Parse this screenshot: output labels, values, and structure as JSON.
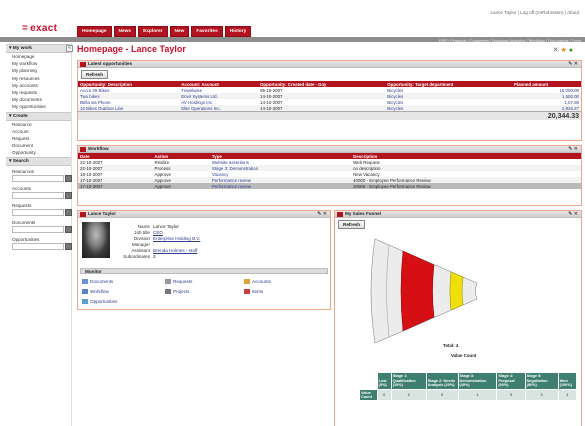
{
  "app": {
    "logo": "exact",
    "logo_prefix": "="
  },
  "top_links": "Lance Taylor | Log off (mrRohrssen) | About",
  "nav_tabs": [
    "Homepage",
    "News",
    "Explorer",
    "New",
    "Favorites",
    "History"
  ],
  "gray_links": "ERP | Financial | Customers | Business Analytics | Workflow | Documents | Tools",
  "sidebar": {
    "my_work_header": "My work",
    "my_work_items": [
      "Homepage",
      "My workflow",
      "My planning",
      "My resources",
      "My accounts",
      "My requests",
      "My documents",
      "My opportunities"
    ],
    "create_header": "Create",
    "create_items": [
      "Resource",
      "Account",
      "Request",
      "Document",
      "Opportunity"
    ],
    "search_header": "Search",
    "search_fields": [
      "Resources",
      "Accounts",
      "Requests",
      "Documents",
      "Opportunities"
    ]
  },
  "page": {
    "title": "Homepage - Lance Taylor"
  },
  "opportunities": {
    "title": "Latest opportunities",
    "refresh_label": "Refresh",
    "columns": [
      "Opportunity: Description",
      "Account: Account",
      "Opportunity: Created date - Day",
      "Opportunity: Target department",
      "Planned amount"
    ],
    "rows": [
      [
        "Accru 25 Bikes",
        "Travelwise",
        "05-10-2007",
        "Bicycles",
        "15,000.00"
      ],
      [
        "Two bikes",
        "Envir Systems Ltd.",
        "14-10-2007",
        "Bicycles",
        "1,500.00"
      ],
      [
        "Bella via Phone",
        "AV Holdings Inc.",
        "14-10-2007",
        "Bicycles",
        "1,07.98"
      ],
      [
        "10 Bikes Outdoor Line",
        "Elite Operations Inc.",
        "14-10-2007",
        "Bicycles",
        "2,926.27"
      ]
    ],
    "total": "20,344.33"
  },
  "workflow": {
    "title": "Workflow",
    "columns": [
      "Date",
      "Action",
      "Type",
      "Description"
    ],
    "rows": [
      [
        "22-10-2007",
        "Realize",
        "Website assertions",
        "Web Request"
      ],
      [
        "22-10-2007",
        "Process",
        "Stage 3: Demonstration",
        "no description"
      ],
      [
        "18-10-2007",
        "Approve",
        "Vacancy",
        "New Vacancy"
      ],
      [
        "17-10-2007",
        "Approve",
        "Performance review",
        "40000 - Employee Performance Review"
      ],
      [
        "17-10-2007",
        "Approve",
        "Performance review",
        "20000 - Employee Performance Review"
      ]
    ]
  },
  "profile": {
    "title": "Lance Taylor",
    "fields": [
      {
        "k": "Name",
        "v": "Lance Taylor"
      },
      {
        "k": "Job title",
        "v": "CEO"
      },
      {
        "k": "Division",
        "v": "Enterprise Holding B.V."
      },
      {
        "k": "Manager",
        "v": ""
      },
      {
        "k": "Assistant",
        "v": "Brenda Holmes - staff"
      },
      {
        "k": "Subordinates",
        "v": "3"
      }
    ],
    "monitor_label": "Monitor",
    "monitor_items": [
      "Documents",
      "Requests",
      "Accounts",
      "Workflow",
      "Projects",
      "Items",
      "Opportunities"
    ]
  },
  "funnel": {
    "title": "My Sales Funnel",
    "refresh_label": "Refresh",
    "total_label": "Total: 4",
    "value_label": "Value Count",
    "colors": {
      "qualification": "#d60f14",
      "proposal": "#efe00c",
      "empty": "#ececec",
      "header": "#3f7f6f"
    }
  },
  "chart_data": {
    "type": "table",
    "columns": [
      "Lost (0%)",
      "Stage 1: Qualification (10%)",
      "Stage 2: Needs Analysis (20%)",
      "Stage 3: Demonstration (40%)",
      "Stage 4: Proposal (60%)",
      "Stage 5: Negotiation (80%)",
      "Won (100%)"
    ],
    "row_label": "Value Count",
    "values": [
      "0",
      "2",
      "0",
      "1",
      "0",
      "0",
      "1"
    ]
  }
}
